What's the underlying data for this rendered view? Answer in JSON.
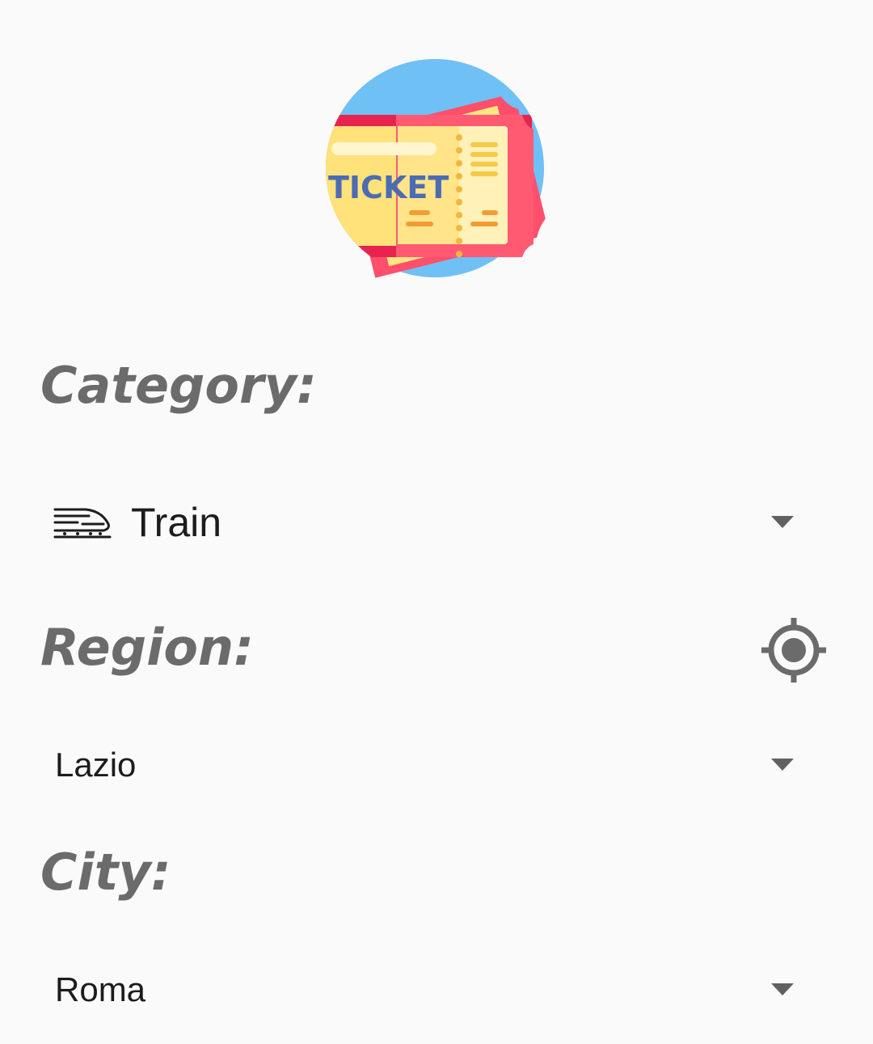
{
  "logo": {
    "icon": "ticket-logo-icon",
    "text": "TICKET"
  },
  "category": {
    "label": "Category:",
    "selected_value": "Train",
    "icon": "train-icon"
  },
  "region": {
    "label": "Region:",
    "selected_value": "Lazio",
    "locate_icon": "my-location-icon"
  },
  "city": {
    "label": "City:",
    "selected_value": "Roma"
  },
  "colors": {
    "background": "#fafafa",
    "label": "#6b6b6b",
    "value_text": "#1c1c1c",
    "arrow": "#616161",
    "logo_circle": "#6fc0f5",
    "ticket_red": "#ff4f6b",
    "ticket_yellow": "#ffe06b",
    "ticket_text": "#4c6bb3"
  }
}
